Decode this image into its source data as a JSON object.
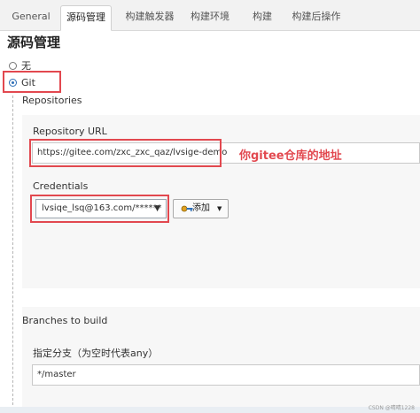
{
  "tabs": [
    {
      "label": "General"
    },
    {
      "label": "源码管理"
    },
    {
      "label": "构建触发器"
    },
    {
      "label": "构建环境"
    },
    {
      "label": "构建"
    },
    {
      "label": "构建后操作"
    }
  ],
  "active_tab": "源码管理",
  "section_title": "源码管理",
  "scm_options": [
    {
      "label": "无",
      "selected": false
    },
    {
      "label": "Git",
      "selected": true
    }
  ],
  "repositories": {
    "heading": "Repositories",
    "url_label": "Repository URL",
    "url_value": "https://gitee.com/zxc_zxc_qaz/lvsige-demo",
    "credentials_label": "Credentials",
    "credentials_value": "lvsiqe_lsq@163.com/******",
    "add_button_label": "添加",
    "add_button_icon": "key-icon"
  },
  "annotation": "你gitee仓库的地址",
  "branches": {
    "heading": "Branches to build",
    "specifier_label": "指定分支（为空时代表any）",
    "specifier_value": "*/master"
  },
  "watermark": "CSDN @晴晴1228",
  "colors": {
    "highlight_red": "#e2484f",
    "radio_blue": "#2e6fb7"
  }
}
